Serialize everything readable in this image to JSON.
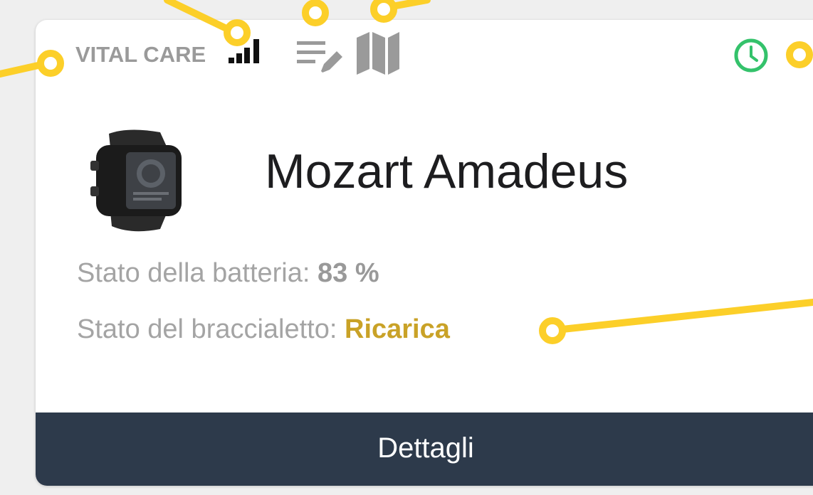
{
  "colors": {
    "page_background": "#efefef",
    "card_background": "#ffffff",
    "footer_background": "#2d3a4b",
    "status_accent": "#c9a227",
    "clock_green": "#34c26b",
    "annotation_yellow": "#fccf29"
  },
  "header": {
    "brand": "VITAL CARE",
    "icons": [
      "signal-strength-icon",
      "edit-list-icon",
      "map-icon",
      "clock-icon"
    ]
  },
  "device": {
    "image": "smartwatch-icon",
    "name": "Mozart Amadeus"
  },
  "battery": {
    "label": "Stato della batteria: ",
    "value": "83 %"
  },
  "bracelet": {
    "label": "Stato del braccialetto: ",
    "value": "Ricarica"
  },
  "footer": {
    "button_label": "Dettagli"
  }
}
